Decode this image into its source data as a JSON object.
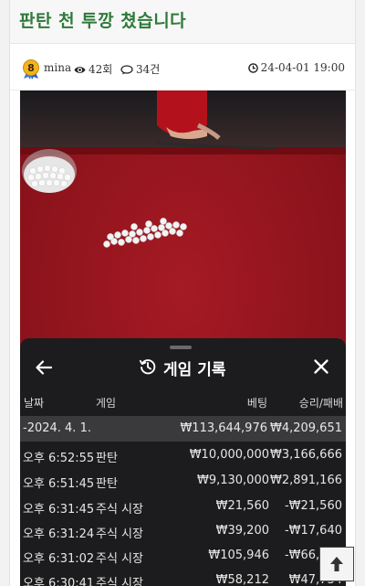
{
  "post": {
    "title": "판탄 천 투깡 쳤습니다"
  },
  "meta": {
    "level": "8",
    "author": "mina",
    "views": "42회",
    "comments": "34건",
    "date": "24-04-01 19:00"
  },
  "modal": {
    "title": "게임 기록",
    "columns": {
      "date": "날짜",
      "game": "게임",
      "bet": "베팅",
      "result": "승리/패배"
    },
    "date_band": {
      "date": "-2024. 4. 1.",
      "bet_total": "₩113,644,976",
      "result_total": "₩4,209,651"
    },
    "rows": [
      {
        "time": "오후 6:52:55",
        "game": "판탄",
        "bet": "₩10,000,000",
        "result": "₩3,166,666"
      },
      {
        "time": "오후 6:51:45",
        "game": "판탄",
        "bet": "₩9,130,000",
        "result": "₩2,891,166"
      },
      {
        "time": "오후 6:31:45",
        "game": "주식 시장",
        "bet": "₩21,560",
        "result": "-₩21,560"
      },
      {
        "time": "오후 6:31:24",
        "game": "주식 시장",
        "bet": "₩39,200",
        "result": "-₩17,640"
      },
      {
        "time": "오후 6:31:02",
        "game": "주식 시장",
        "bet": "₩105,946",
        "result": "-₩66,746"
      },
      {
        "time": "오후 6:30:41",
        "game": "주식 시장",
        "bet": "₩58,212",
        "result": "₩47,734"
      }
    ]
  },
  "colors": {
    "title_green": "#2f7a3b",
    "table_felt": "#8e141d",
    "modal_bg": "#1c1c1e",
    "date_band": "#3a3a3c"
  },
  "icons": {
    "views": "eye-icon",
    "comments": "comment-icon",
    "date": "clock-icon",
    "back": "back-arrow-icon",
    "history": "history-icon",
    "close": "close-icon",
    "scroll_top": "arrow-up-icon"
  }
}
